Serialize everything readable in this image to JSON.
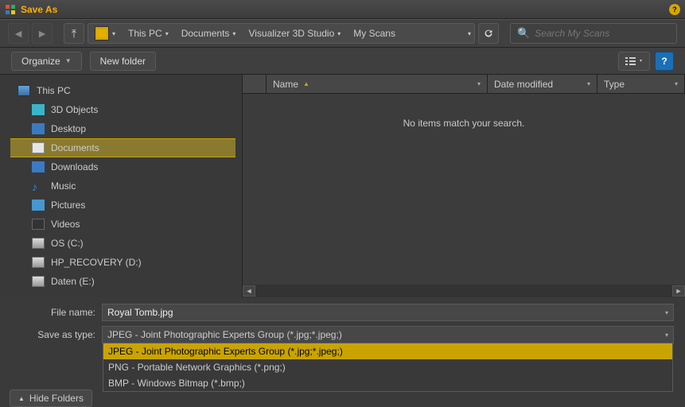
{
  "window": {
    "title": "Save As"
  },
  "nav": {
    "breadcrumbs": [
      "This PC",
      "Documents",
      "Visualizer 3D Studio",
      "My Scans"
    ]
  },
  "search": {
    "placeholder": "Search My Scans"
  },
  "toolbar": {
    "organize": "Organize",
    "new_folder": "New folder"
  },
  "sidebar": {
    "root": "This PC",
    "items": [
      {
        "label": "3D Objects",
        "icon": "ico-3d"
      },
      {
        "label": "Desktop",
        "icon": "ico-desk"
      },
      {
        "label": "Documents",
        "icon": "ico-doc",
        "selected": true
      },
      {
        "label": "Downloads",
        "icon": "ico-dl"
      },
      {
        "label": "Music",
        "icon": "ico-music",
        "glyph": "♪"
      },
      {
        "label": "Pictures",
        "icon": "ico-pic"
      },
      {
        "label": "Videos",
        "icon": "ico-vid"
      },
      {
        "label": "OS (C:)",
        "icon": "ico-drive"
      },
      {
        "label": "HP_RECOVERY (D:)",
        "icon": "ico-drive"
      },
      {
        "label": "Daten (E:)",
        "icon": "ico-drive"
      }
    ]
  },
  "columns": {
    "name": "Name",
    "date_modified": "Date modified",
    "type": "Type"
  },
  "list": {
    "empty_message": "No items match your search."
  },
  "form": {
    "file_name_label": "File name:",
    "file_name_value": "Royal Tomb.jpg",
    "save_type_label": "Save as type:",
    "save_type_value": "JPEG - Joint Photographic Experts Group (*.jpg;*.jpeg;)",
    "type_options": [
      "JPEG - Joint Photographic Experts Group (*.jpg;*.jpeg;)",
      "PNG - Portable Network Graphics (*.png;)",
      "BMP - Windows Bitmap (*.bmp;)"
    ]
  },
  "footer": {
    "hide_folders": "Hide Folders"
  }
}
